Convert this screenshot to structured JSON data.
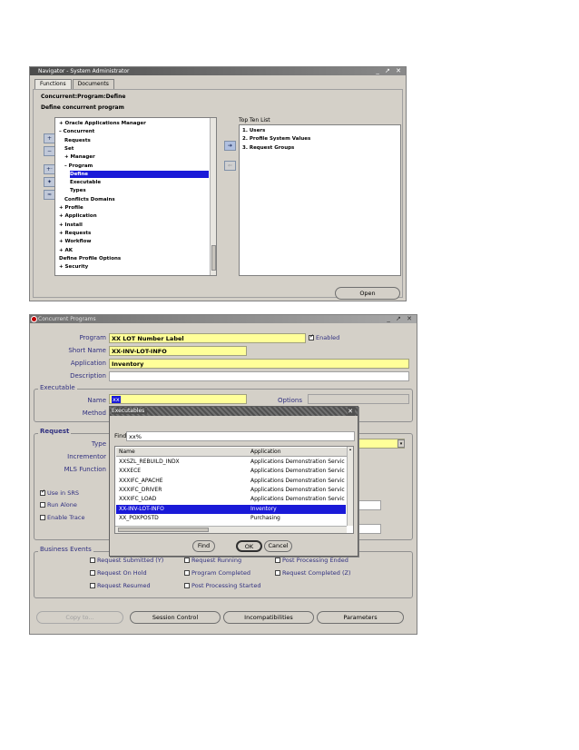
{
  "navigator": {
    "title": "Navigator - System Administrator",
    "tabs": [
      "Functions",
      "Documents"
    ],
    "breadcrumb": "Concurrent:Program:Define",
    "subtitle": "Define concurrent program",
    "tree": [
      {
        "prefix": "+",
        "label": "Oracle Applications Manager",
        "indent": 0
      },
      {
        "prefix": "-",
        "label": "Concurrent",
        "indent": 0
      },
      {
        "prefix": "",
        "label": "Requests",
        "indent": 1
      },
      {
        "prefix": "",
        "label": "Set",
        "indent": 1
      },
      {
        "prefix": "+",
        "label": "Manager",
        "indent": 1
      },
      {
        "prefix": "-",
        "label": "Program",
        "indent": 1
      },
      {
        "prefix": "",
        "label": "Define",
        "indent": 2,
        "selected": true
      },
      {
        "prefix": "",
        "label": "Executable",
        "indent": 2
      },
      {
        "prefix": "",
        "label": "Types",
        "indent": 2
      },
      {
        "prefix": "",
        "label": "Conflicts Domains",
        "indent": 1
      },
      {
        "prefix": "+",
        "label": "Profile",
        "indent": 0
      },
      {
        "prefix": "+",
        "label": "Application",
        "indent": 0
      },
      {
        "prefix": "+",
        "label": "Install",
        "indent": 0
      },
      {
        "prefix": "+",
        "label": "Requests",
        "indent": 0
      },
      {
        "prefix": "+",
        "label": "Workflow",
        "indent": 0
      },
      {
        "prefix": "+",
        "label": "AK",
        "indent": 0
      },
      {
        "prefix": "",
        "label": "Define Profile Options",
        "indent": 0
      },
      {
        "prefix": "+",
        "label": "Security",
        "indent": 0
      }
    ],
    "top_ten_label": "Top Ten List",
    "top_ten": [
      "1. Users",
      "2. Profile System Values",
      "3. Request Groups"
    ],
    "open_button": "Open"
  },
  "conc": {
    "title": "Concurrent Programs",
    "program_label": "Program",
    "program_value": "XX LOT Number Label",
    "enabled_label": "Enabled",
    "short_name_label": "Short Name",
    "short_name_value": "XX-INV-LOT-INFO",
    "application_label": "Application",
    "application_value": "Inventory",
    "description_label": "Description",
    "executable_section": "Executable",
    "exe_name_label": "Name",
    "exe_name_value": "xx",
    "options_label": "Options",
    "method_label": "Method",
    "request_section": "Request",
    "type_label": "Type",
    "incrementor_label": "Incrementor",
    "mls_label": "MLS Function",
    "use_in_srs": "Use in SRS",
    "run_alone": "Run Alone",
    "enable_trace": "Enable Trace",
    "business_events_section": "Business Events",
    "events": [
      [
        "Request Submitted (Y)",
        "Request Running",
        "Post Processing Ended"
      ],
      [
        "Request On Hold",
        "Program Completed",
        "Request Completed (Z)"
      ],
      [
        "Request Resumed",
        "Post Processing Started",
        ""
      ]
    ],
    "buttons": [
      "Copy to...",
      "Session Control",
      "Incompatibilities",
      "Parameters"
    ]
  },
  "dialog": {
    "title": "Executables",
    "find_label": "Find",
    "find_value": "xx%",
    "col_name": "Name",
    "col_app": "Application",
    "rows": [
      {
        "name": "XXSZL_REBUILD_INDX",
        "app": "Applications Demonstration Servic"
      },
      {
        "name": "XXXECE",
        "app": "Applications Demonstration Servic"
      },
      {
        "name": "XXXIFC_APACHE",
        "app": "Applications Demonstration Servic"
      },
      {
        "name": "XXXIFC_DRIVER",
        "app": "Applications Demonstration Servic"
      },
      {
        "name": "XXXIFC_LOAD",
        "app": "Applications Demonstration Servic"
      },
      {
        "name": "XX-INV-LOT-INFO",
        "app": "Inventory",
        "selected": true
      },
      {
        "name": "XX_POXPOSTD",
        "app": "Purchasing"
      }
    ],
    "find_button": "Find",
    "ok_button": "OK",
    "cancel_button": "Cancel"
  }
}
